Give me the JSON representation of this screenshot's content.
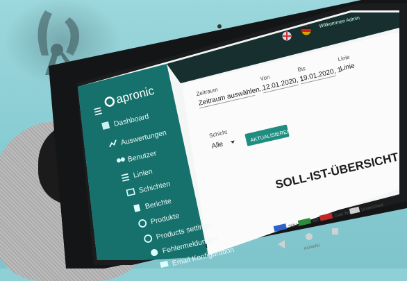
{
  "photo": {
    "description_tags": [
      "tablet",
      "gloves",
      "pliers"
    ]
  },
  "app": {
    "logo": "apronic",
    "topbar_user": "Willkommen Admin",
    "sidebar": [
      {
        "label": "Dashboard",
        "icon": "dashboard-icon"
      },
      {
        "label": "Auswertungen",
        "icon": "chart-line-icon"
      },
      {
        "label": "Benutzer",
        "icon": "users-icon"
      },
      {
        "label": "Linien",
        "icon": "lines-icon"
      },
      {
        "label": "Schichten",
        "icon": "layers-icon"
      },
      {
        "label": "Berichte",
        "icon": "report-icon"
      },
      {
        "label": "Produkte",
        "icon": "product-icon"
      },
      {
        "label": "Products settings",
        "icon": "settings-icon"
      },
      {
        "label": "Fehlermeldungen",
        "icon": "error-icon"
      },
      {
        "label": "Email Konfiguration",
        "icon": "email-icon"
      }
    ],
    "filters": {
      "zeitraum_label": "Zeitraum",
      "zeitraum_value": "Zeitraum auswählen...",
      "von_label": "Von",
      "von_value": "12.01.2020, 1",
      "bis_label": "Bis",
      "bis_value": "19.01.2020, 1",
      "linie_label": "Linie",
      "linie_value": "Linie",
      "schicht_label": "Schicht",
      "schicht_value": "Alle",
      "update_button": "AKTUALISIEREN"
    },
    "chart_title": "SOLL-IST-ÜBERSICHT",
    "legend": [
      "SOLL",
      "IST",
      "Over Test",
      "Unterschied"
    ],
    "tablet_brand": "HUAWEI",
    "colors": {
      "sidebar": "#16706b",
      "accent": "#1f8d7f",
      "soll": "#2f63c9",
      "ist": "#2e8b3b",
      "over": "#c0262b"
    }
  }
}
